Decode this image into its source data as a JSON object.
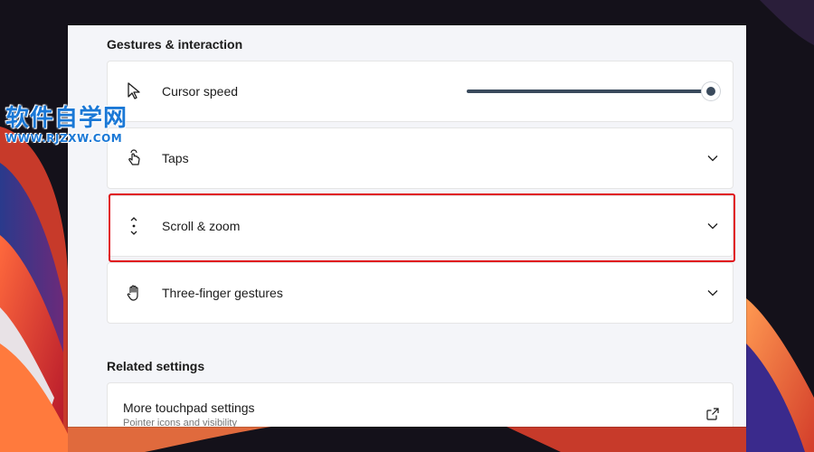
{
  "gestures_section": {
    "title": "Gestures & interaction",
    "cursor_speed": {
      "label": "Cursor speed",
      "value_fraction": 1.0
    },
    "taps": {
      "label": "Taps"
    },
    "scroll_zoom": {
      "label": "Scroll & zoom"
    },
    "three_finger": {
      "label": "Three-finger gestures"
    }
  },
  "related_section": {
    "title": "Related settings",
    "more_touchpad": {
      "label": "More touchpad settings",
      "sublabel": "Pointer icons and visibility"
    }
  },
  "watermark": {
    "title": "软件自学网",
    "url": "WWW.RJZXW.COM"
  },
  "colors": {
    "highlight": "#e0131b",
    "accent": "#3a4a5c",
    "watermark": "#1a78d6"
  },
  "icons": {
    "cursor": "cursor-icon",
    "taps": "tap-hand-icon",
    "scroll": "scroll-icon",
    "three_finger": "hand-icon",
    "external": "open-external-icon",
    "chevron": "chevron-down-icon"
  }
}
